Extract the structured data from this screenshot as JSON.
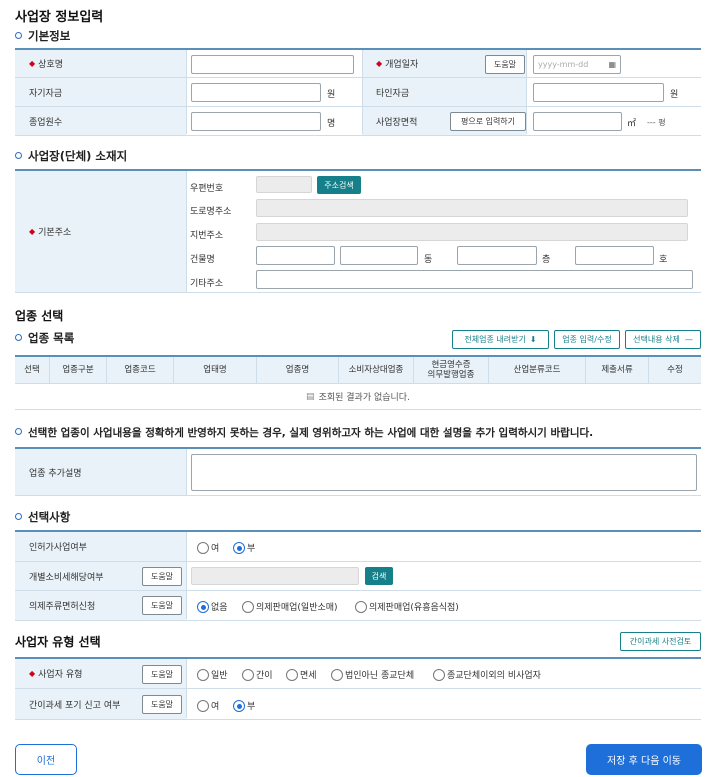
{
  "page_title": "사업장 정보입력",
  "basic": {
    "title": "기본정보",
    "trade_name_label": "상호명",
    "open_date_label": "개업일자",
    "help_label": "도움말",
    "date_placeholder": "yyyy-mm-dd",
    "own_fund_label": "자기자금",
    "others_fund_label": "타인자금",
    "won": "원",
    "employees_label": "종업원수",
    "person_unit": "명",
    "area_label": "사업장면적",
    "pyeong_input_btn": "평으로 입력하기",
    "sqm_unit": "㎡",
    "pyeong_readout": "--- 평"
  },
  "location": {
    "title": "사업장(단체) 소재지",
    "basic_address_label": "기본주소",
    "zip_label": "우편번호",
    "address_search_btn": "주소검색",
    "road_label": "도로명주소",
    "lot_label": "지번주소",
    "building_label": "건물명",
    "dong": "동",
    "floor": "층",
    "ho": "호",
    "etc_label": "기타주소"
  },
  "industry": {
    "section_title": "업종 선택",
    "list_title": "업종 목록",
    "btn_download": "전체업종 내려받기",
    "btn_input": "업종 입력/수정",
    "btn_delete": "선택내용 삭제",
    "columns": [
      "선택",
      "업종구분",
      "업종코드",
      "업태명",
      "업종명",
      "소비자상대업종",
      "현금영수증\n의무발행업종",
      "산업분류코드",
      "제출서류",
      "수정"
    ],
    "empty_message": "조회된 결과가 없습니다.",
    "notice": "선택한 업종이 사업내용을 정확하게 반영하지 못하는 경우, 실제 영위하고자 하는 사업에 대한 설명을 추가 입력하시기 바랍니다.",
    "extra_desc_label": "업종 추가설명"
  },
  "options": {
    "title": "선택사항",
    "license_label": "인허가사업여부",
    "yes": "여",
    "no": "부",
    "excise_label": "개별소비세해당여부",
    "help_label": "도움말",
    "search_btn": "검색",
    "liquor_label": "의제주류면허신청",
    "liquor_opts": [
      "없음",
      "의제판매업(일반소매)",
      "의제판매업(유흥음식점)"
    ]
  },
  "biz_type": {
    "title": "사업자 유형 선택",
    "precheck_btn": "간이과세 사전검토",
    "type_label": "사업자 유형",
    "help_label": "도움말",
    "type_opts": [
      "일반",
      "간이",
      "면세",
      "법인아닌 종교단체",
      "종교단체이외의 비사업자"
    ],
    "waive_label": "간이과세 포기 신고 여부",
    "yes": "여",
    "no": "부"
  },
  "nav": {
    "prev": "이전",
    "next": "저장 후 다음 이동"
  },
  "colors": {
    "primary": "#1e6fd9",
    "teal": "#16808a",
    "header_bg": "#e8f2f8",
    "required": "#d0021b"
  }
}
